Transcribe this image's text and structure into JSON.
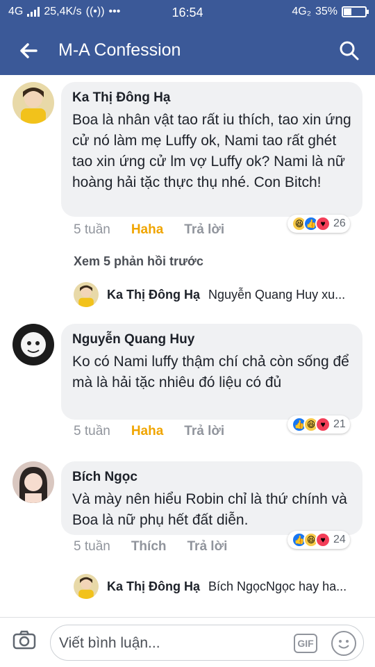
{
  "statusbar": {
    "network_left": "4G",
    "speed": "25,4K/s",
    "dots": "•••",
    "time": "16:54",
    "network_right": "4G₂",
    "battery": "35%",
    "battery_level": 0.35
  },
  "header": {
    "title": "M-A Confession",
    "back_icon": "arrow-left-icon",
    "search_icon": "search-icon"
  },
  "comments": [
    {
      "name": "Ka Thị Đông Hạ",
      "text": "Boa là nhân vật tao rất iu thích,  tao xin ứng cử nó làm mẹ Luffy ok,  Nami tao rất ghét tao xin ứng cử lm vợ Luffy  ok?  Nami là nữ hoàng hải tặc thực thụ nhé.  Con Bitch!",
      "time": "5 tuần",
      "react_label": "Haha",
      "reply_label": "Trả lời",
      "reaction_count": "26"
    },
    {
      "name": "Nguyễn Quang Huy",
      "text": "Ko có Nami luffy thậm chí chả còn sống để mà là hải tặc nhiêu đó liệu có đủ",
      "time": "5 tuần",
      "react_label": "Haha",
      "reply_label": "Trả lời",
      "reaction_count": "21"
    },
    {
      "name": "Bích Ngọc",
      "text": "Và mày nên hiểu Robin chỉ là thứ chính và Boa là nữ phụ hết đất diễn.",
      "time": "5 tuần",
      "react_label": "Thích",
      "reply_label": "Trả lời",
      "reaction_count": "24"
    }
  ],
  "more_replies": "Xem 5 phản hồi trước",
  "reply_previews": [
    {
      "name": "Ka Thị Đông Hạ",
      "text": "Nguyễn Quang Huy xu..."
    },
    {
      "name": "Ka Thị Đông Hạ",
      "text": "Bích NgọcNgọc hay ha..."
    }
  ],
  "composer": {
    "placeholder": "Viết bình luận...",
    "gif_label": "GIF"
  },
  "colors": {
    "brand": "#3b5998",
    "haha_active": "#f0a500",
    "meta": "#90949c",
    "bubble": "#f0f1f3"
  }
}
